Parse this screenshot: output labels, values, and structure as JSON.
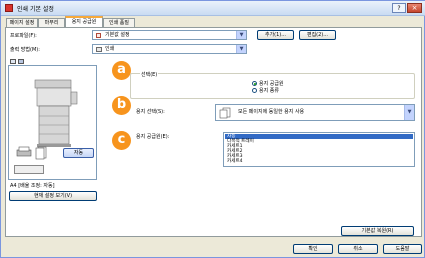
{
  "window": {
    "title": "인쇄 기본 설정",
    "help_label": "?",
    "close_label": "×"
  },
  "tabs": [
    {
      "label": "페이지 설정"
    },
    {
      "label": "마무리"
    },
    {
      "label": "용지 공급원"
    },
    {
      "label": "인쇄 품질"
    }
  ],
  "profile": {
    "label": "프로파일(F):",
    "value": "기본값 설정",
    "add_label": "추가(1)...",
    "edit_label": "편집(2)..."
  },
  "output": {
    "label": "출력 방법(M):",
    "value": "인쇄"
  },
  "preview": {
    "mode_label": "자동",
    "caption": "A4 [배율 조정: 자동]",
    "view_settings_label": "현재 설정 보기(V)"
  },
  "callouts": [
    "a",
    "b",
    "c"
  ],
  "selection": {
    "group_label": "선택(E)",
    "options": [
      {
        "label": "용지 공급원",
        "selected": true
      },
      {
        "label": "용지 종류",
        "selected": false
      }
    ]
  },
  "paper_selection": {
    "label": "용지 선택(S):",
    "value": "모든 페이지에 동일한 용지 사용"
  },
  "paper_source": {
    "label": "용지 공급원(E):",
    "items": [
      {
        "label": "자동",
        "selected": true
      },
      {
        "label": "다목적 트레이",
        "selected": false
      },
      {
        "label": "카세트1",
        "selected": false
      },
      {
        "label": "카세트2",
        "selected": false
      },
      {
        "label": "카세트3",
        "selected": false
      },
      {
        "label": "카세트4",
        "selected": false
      }
    ]
  },
  "restore_label": "기본값 복원(R)",
  "footer": {
    "ok": "확인",
    "cancel": "취소",
    "help": "도움말"
  }
}
